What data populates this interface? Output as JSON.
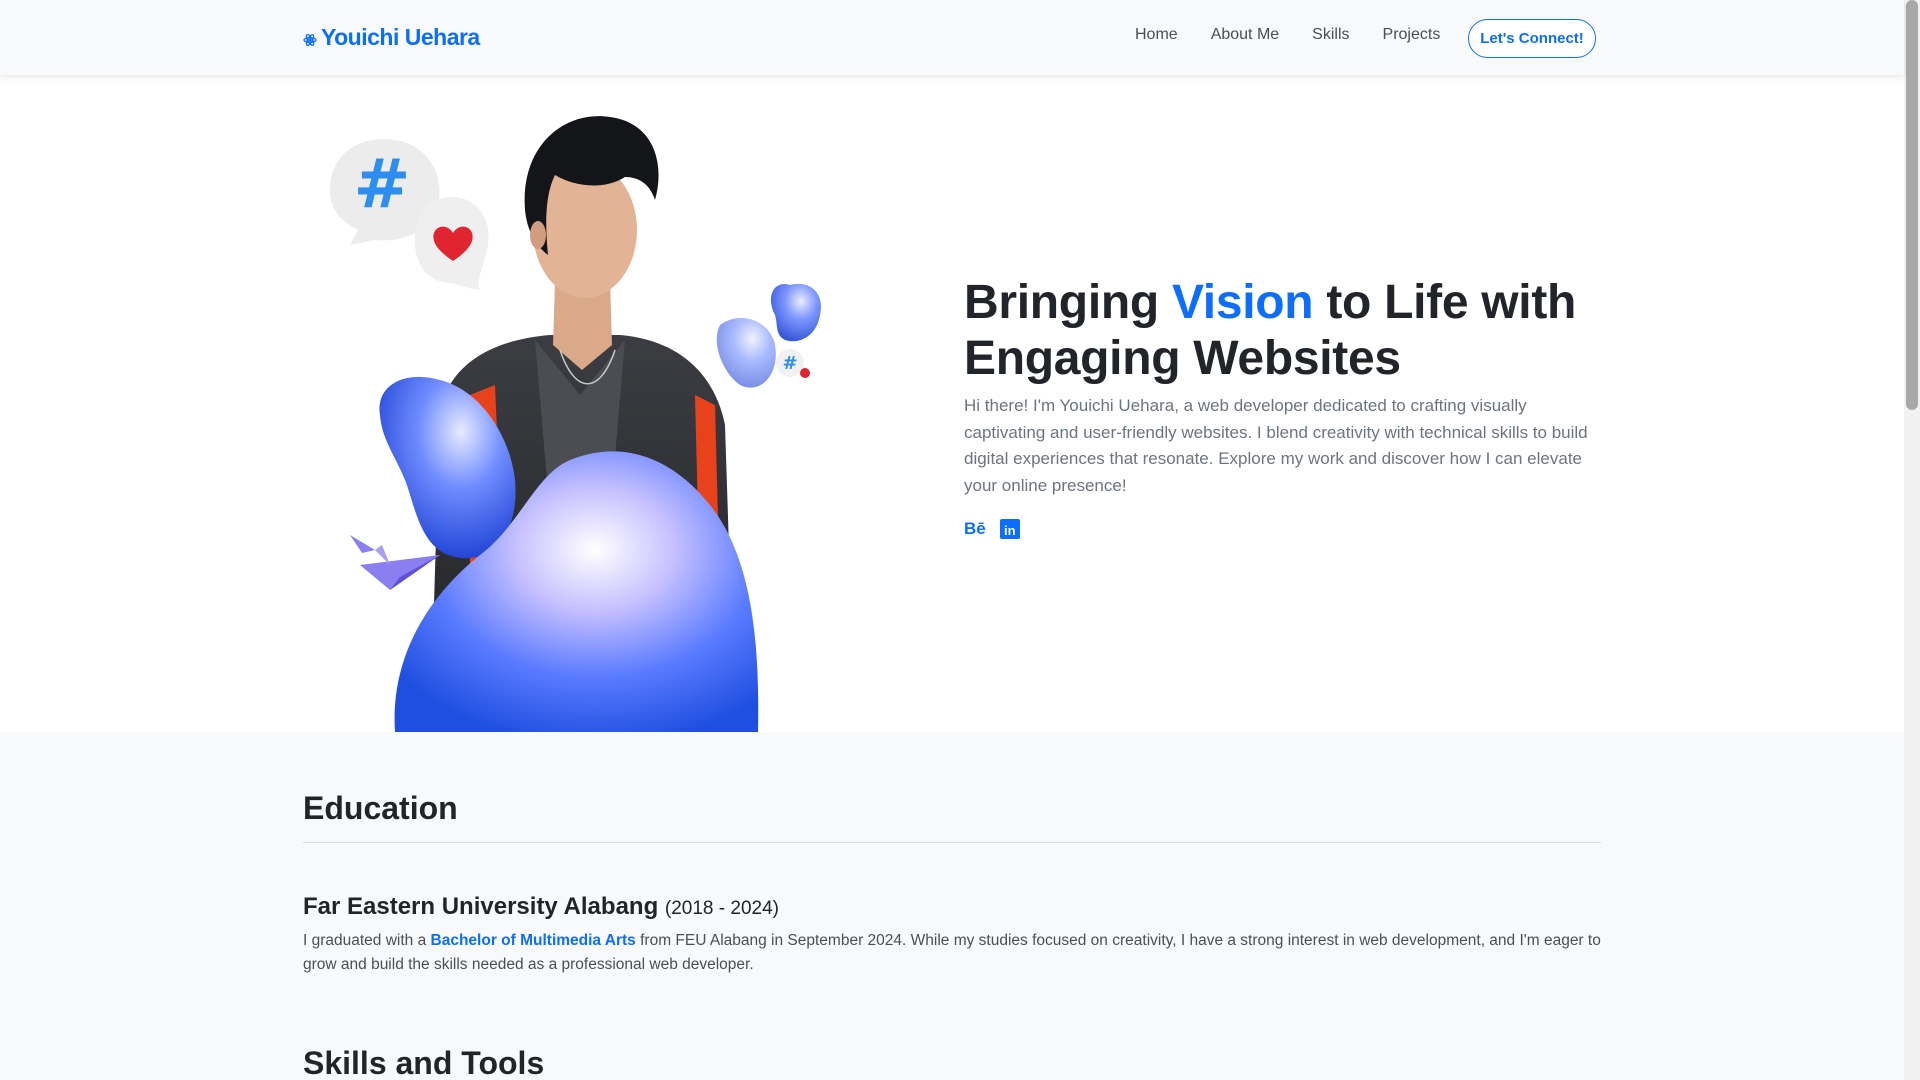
{
  "nav": {
    "brand": "Youichi Uehara",
    "links": [
      "Home",
      "About Me",
      "Skills",
      "Projects"
    ],
    "cta": "Let's Connect!"
  },
  "hero": {
    "title_pre": "Bringing ",
    "title_accent": "Vision",
    "title_post": " to Life with Engaging Websites",
    "description": "Hi there! I'm Youichi Uehara, a web developer dedicated to crafting visually captivating and user-friendly websites. I blend creativity with technical skills to build digital experiences that resonate. Explore my work and discover how I can elevate your online presence!",
    "socials": {
      "behance": "Bē",
      "linkedin": "in"
    }
  },
  "education": {
    "heading": "Education",
    "school": "Far Eastern University Alabang",
    "years": "(2018 - 2024)",
    "text_pre": "I graduated with a ",
    "degree": "Bachelor of Multimedia Arts",
    "text_post": " from FEU Alabang in September 2024. While my studies focused on creativity, I have a strong interest in web development, and I'm eager to grow and build the skills needed as a professional web developer."
  },
  "skills": {
    "heading": "Skills and Tools"
  },
  "colors": {
    "accent": "#0d6efd",
    "text": "#212529",
    "muted": "#6c757d",
    "page_bg": "#f8f9fa"
  }
}
